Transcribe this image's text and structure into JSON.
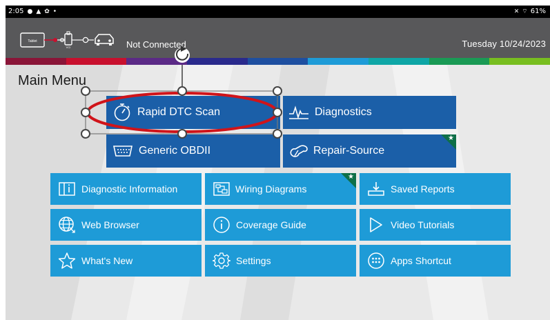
{
  "status_bar": {
    "time": "2:05",
    "left_icons": [
      "notification-dot-icon",
      "warning-icon",
      "settings-icon",
      "dot-icon"
    ],
    "battery": "61%"
  },
  "header": {
    "connection_status": "Not Connected",
    "tablet_label": "Tablet",
    "vci_label": "VCI",
    "date": "Tuesday 10/24/2023"
  },
  "stripe_colors": [
    "#8a1538",
    "#c8102e",
    "#5b2a86",
    "#2a2a8c",
    "#1e4fa0",
    "#1e9bd7",
    "#0fa6a6",
    "#1a9a55",
    "#78be20"
  ],
  "main_menu": {
    "title": "Main Menu",
    "primary_tiles": [
      {
        "label": "Rapid DTC Scan",
        "icon": "stopwatch-icon"
      },
      {
        "label": "Diagnostics",
        "icon": "waveform-icon"
      },
      {
        "label": "Generic OBDII",
        "icon": "obd-connector-icon"
      },
      {
        "label": "Repair-Source",
        "icon": "wrench-icon",
        "badge": "star"
      }
    ],
    "secondary_tiles": [
      {
        "label": "Diagnostic Information",
        "icon": "info-book-icon"
      },
      {
        "label": "Wiring Diagrams",
        "icon": "wiring-diagram-icon",
        "badge": "star"
      },
      {
        "label": "Saved Reports",
        "icon": "download-tray-icon"
      },
      {
        "label": "Web Browser",
        "icon": "globe-icon"
      },
      {
        "label": "Coverage Guide",
        "icon": "info-circle-icon"
      },
      {
        "label": "Video Tutorials",
        "icon": "play-icon"
      },
      {
        "label": "What's New",
        "icon": "star-outline-icon"
      },
      {
        "label": "Settings",
        "icon": "gear-icon"
      },
      {
        "label": "Apps Shortcut",
        "icon": "apps-grid-icon"
      }
    ]
  },
  "colors": {
    "primary_tile": "#1b5fa8",
    "secondary_tile": "#1e9bd7",
    "badge": "#0e6f48",
    "annotation_ellipse": "#d0141a",
    "header_bg": "#58585a"
  }
}
